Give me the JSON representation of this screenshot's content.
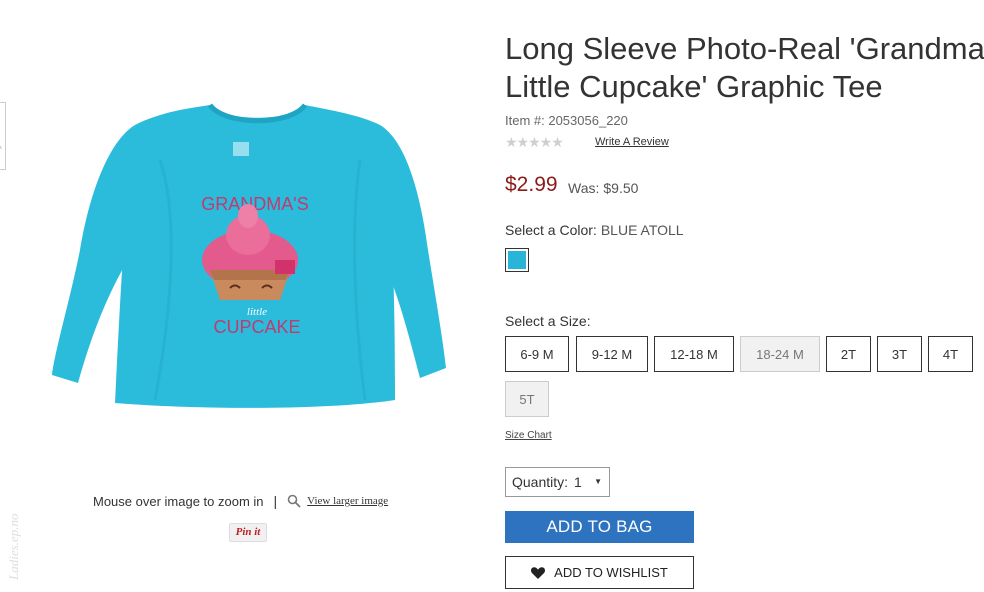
{
  "product": {
    "title_line1": "Long Sleeve Photo-Real 'Grandma's",
    "title_line2": "Little Cupcake' Graphic Tee",
    "item_number": "Item #: 2053056_220",
    "write_review": "Write A Review",
    "price": "$2.99",
    "was_label": "Was:",
    "was_price": "$9.50",
    "image_text_top": "GRANDMA'S",
    "image_text_mid": "little",
    "image_text_bottom": "CUPCAKE",
    "shirt_color": "#2bbcdc"
  },
  "image_tools": {
    "zoom_hint": "Mouse over image to zoom in",
    "separator": "|",
    "larger_image": "View larger image",
    "pin_it": "Pin it"
  },
  "color": {
    "label": "Select a Color:",
    "selected": "BLUE ATOLL",
    "swatch_hex": "#29b5d8"
  },
  "size": {
    "label": "Select a Size:",
    "options": [
      "6-9 M",
      "9-12 M",
      "12-18 M",
      "18-24 M",
      "2T",
      "3T",
      "4T",
      "5T"
    ],
    "unavailable": [
      "18-24 M",
      "5T"
    ],
    "chart_link": "Size Chart"
  },
  "quantity": {
    "label": "Quantity:",
    "value": "1"
  },
  "actions": {
    "add_to_bag": "ADD TO BAG",
    "add_to_wishlist": "ADD TO WISHLIST"
  },
  "watermark": "Ladies.ep.no",
  "colors": {
    "price_red": "#8b1a1a",
    "button_blue": "#2d73c0"
  }
}
